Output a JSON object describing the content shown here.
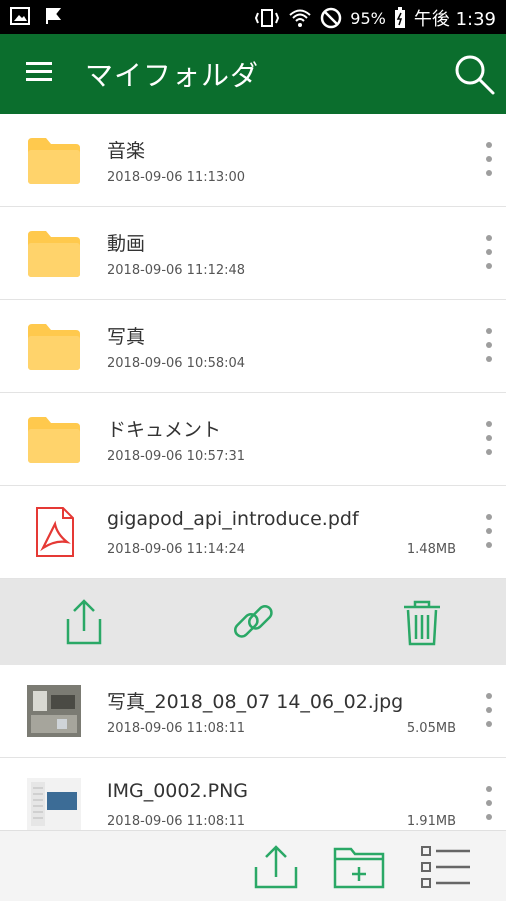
{
  "status_bar": {
    "battery": "95%",
    "time": "午後 1:39",
    "icons": [
      "image-icon",
      "flag-icon",
      "vibrate-icon",
      "wifi-icon",
      "blocked-icon",
      "battery-icon"
    ]
  },
  "app_bar": {
    "title": "マイフォルダ",
    "icons": [
      "menu-icon",
      "search-icon"
    ]
  },
  "files": [
    {
      "name": "音楽",
      "date": "2018-09-06 11:13:00",
      "size": "",
      "type": "folder"
    },
    {
      "name": "動画",
      "date": "2018-09-06 11:12:48",
      "size": "",
      "type": "folder"
    },
    {
      "name": "写真",
      "date": "2018-09-06 10:58:04",
      "size": "",
      "type": "folder"
    },
    {
      "name": "ドキュメント",
      "date": "2018-09-06 10:57:31",
      "size": "",
      "type": "folder"
    },
    {
      "name": "gigapod_api_introduce.pdf",
      "date": "2018-09-06 11:14:24",
      "size": "1.48MB",
      "type": "pdf"
    },
    {
      "name": "写真_2018_08_07 14_06_02.jpg",
      "date": "2018-09-06 11:08:11",
      "size": "5.05MB",
      "type": "jpg"
    },
    {
      "name": "IMG_0002.PNG",
      "date": "2018-09-06 11:08:11",
      "size": "1.91MB",
      "type": "png"
    }
  ],
  "action_bar": {
    "icons": [
      "share-icon",
      "link-icon",
      "trash-icon"
    ]
  },
  "bottom_bar": {
    "icons": [
      "upload-icon",
      "new-folder-icon",
      "list-view-icon"
    ]
  },
  "colors": {
    "app_bar": "#0b6e2d",
    "accent": "#2aa866",
    "folder": "#ffc94d",
    "pdf": "#e53935"
  }
}
